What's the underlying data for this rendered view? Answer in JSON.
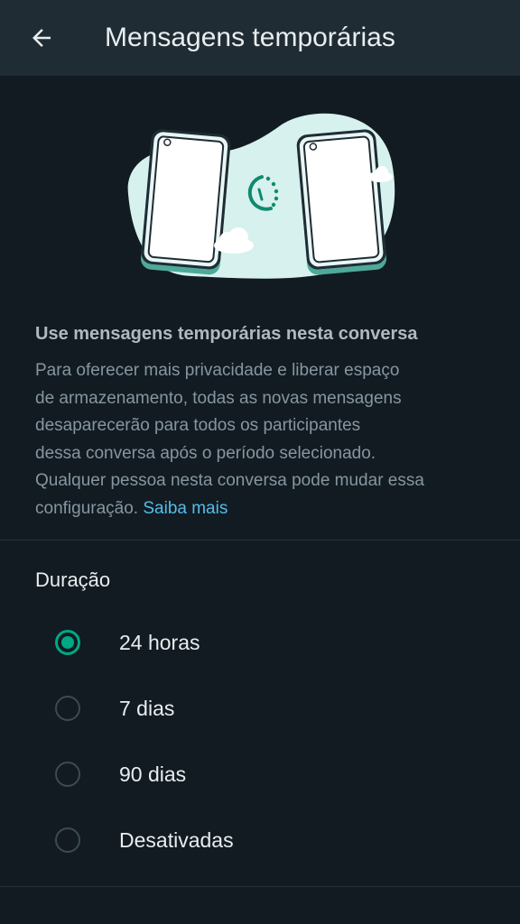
{
  "header": {
    "title": "Mensagens temporárias"
  },
  "info": {
    "heading": "Use mensagens temporárias nesta conversa",
    "description_lines": [
      "Para oferecer mais privacidade e liberar espaço",
      "de armazenamento, todas as novas mensagens",
      "desaparecerão para todos os participantes",
      "dessa conversa após o período selecionado.",
      "Qualquer pessoa nesta conversa pode mudar essa",
      "configuração."
    ],
    "learn_more": "Saiba mais"
  },
  "duration": {
    "label": "Duração",
    "options": [
      {
        "label": "24 horas",
        "selected": true
      },
      {
        "label": "7 dias",
        "selected": false
      },
      {
        "label": "90 dias",
        "selected": false
      },
      {
        "label": "Desativadas",
        "selected": false
      }
    ]
  },
  "colors": {
    "background": "#121b22",
    "app_bar": "#1f2c34",
    "accent": "#00a884",
    "link": "#53bdeb",
    "primary_text": "#e9edef",
    "secondary_text": "#8696a0"
  }
}
